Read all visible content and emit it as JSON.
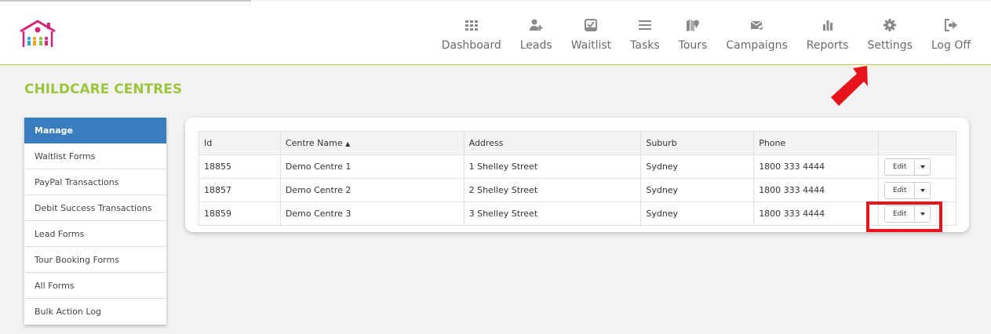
{
  "header": {
    "nav": [
      {
        "label": "Dashboard",
        "icon": "dashboard-grid-icon"
      },
      {
        "label": "Leads",
        "icon": "user-plus-icon"
      },
      {
        "label": "Waitlist",
        "icon": "inbox-check-icon"
      },
      {
        "label": "Tasks",
        "icon": "list-icon"
      },
      {
        "label": "Tours",
        "icon": "map-marker-icon"
      },
      {
        "label": "Campaigns",
        "icon": "envelope-check-icon"
      },
      {
        "label": "Reports",
        "icon": "bar-chart-icon"
      },
      {
        "label": "Settings",
        "icon": "gear-icon"
      },
      {
        "label": "Log Off",
        "icon": "sign-out-icon"
      }
    ]
  },
  "page": {
    "title": "CHILDCARE CENTRES"
  },
  "sidebar": {
    "items": [
      {
        "label": "Manage",
        "active": true
      },
      {
        "label": "Waitlist Forms"
      },
      {
        "label": "PayPal Transactions"
      },
      {
        "label": "Debit Success Transactions"
      },
      {
        "label": "Lead Forms"
      },
      {
        "label": "Tour Booking Forms"
      },
      {
        "label": "All Forms"
      },
      {
        "label": "Bulk Action Log"
      }
    ]
  },
  "table": {
    "headers": {
      "id": "Id",
      "name": "Centre Name",
      "sort_indicator": "▲",
      "address": "Address",
      "suburb": "Suburb",
      "phone": "Phone"
    },
    "edit_label": "Edit",
    "rows": [
      {
        "id": "18855",
        "name": "Demo Centre 1",
        "address": "1 Shelley Street",
        "suburb": "Sydney",
        "phone": "1800 333 4444"
      },
      {
        "id": "18857",
        "name": "Demo Centre 2",
        "address": "2 Shelley Street",
        "suburb": "Sydney",
        "phone": "1800 333 4444"
      },
      {
        "id": "18859",
        "name": "Demo Centre 3",
        "address": "3 Shelley Street",
        "suburb": "Sydney",
        "phone": "1800 333 4444"
      }
    ]
  },
  "colors": {
    "brand_green": "#9dc63f",
    "active_blue": "#3a7dbf",
    "annotation_red": "#e8141b",
    "logo_magenta": "#d4237a"
  }
}
